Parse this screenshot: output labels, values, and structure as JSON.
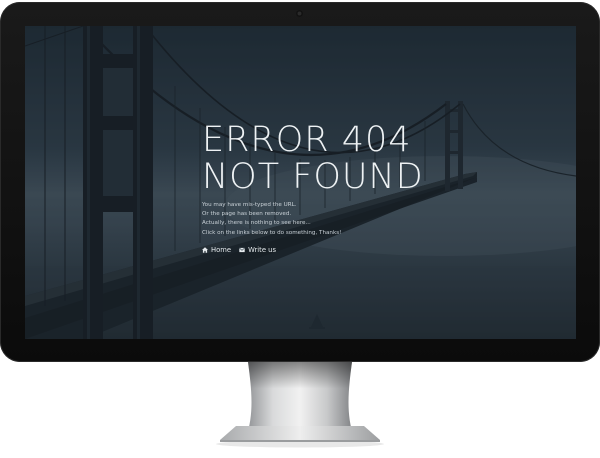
{
  "error": {
    "line1": "ERROR 404",
    "line2": "NOT FOUND"
  },
  "messages": [
    "You may have mis-typed the URL.",
    "Or the page has been removed.",
    "Actually, there is nothing to see here...",
    "Click on the links below to do something, Thanks!"
  ],
  "links": {
    "home": {
      "label": "Home",
      "icon": "home-icon"
    },
    "write": {
      "label": "Write us",
      "icon": "mail-icon"
    }
  },
  "colors": {
    "bezel": "#111111",
    "screen_overlay": "#2d3a45",
    "text": "#eef2f4"
  }
}
